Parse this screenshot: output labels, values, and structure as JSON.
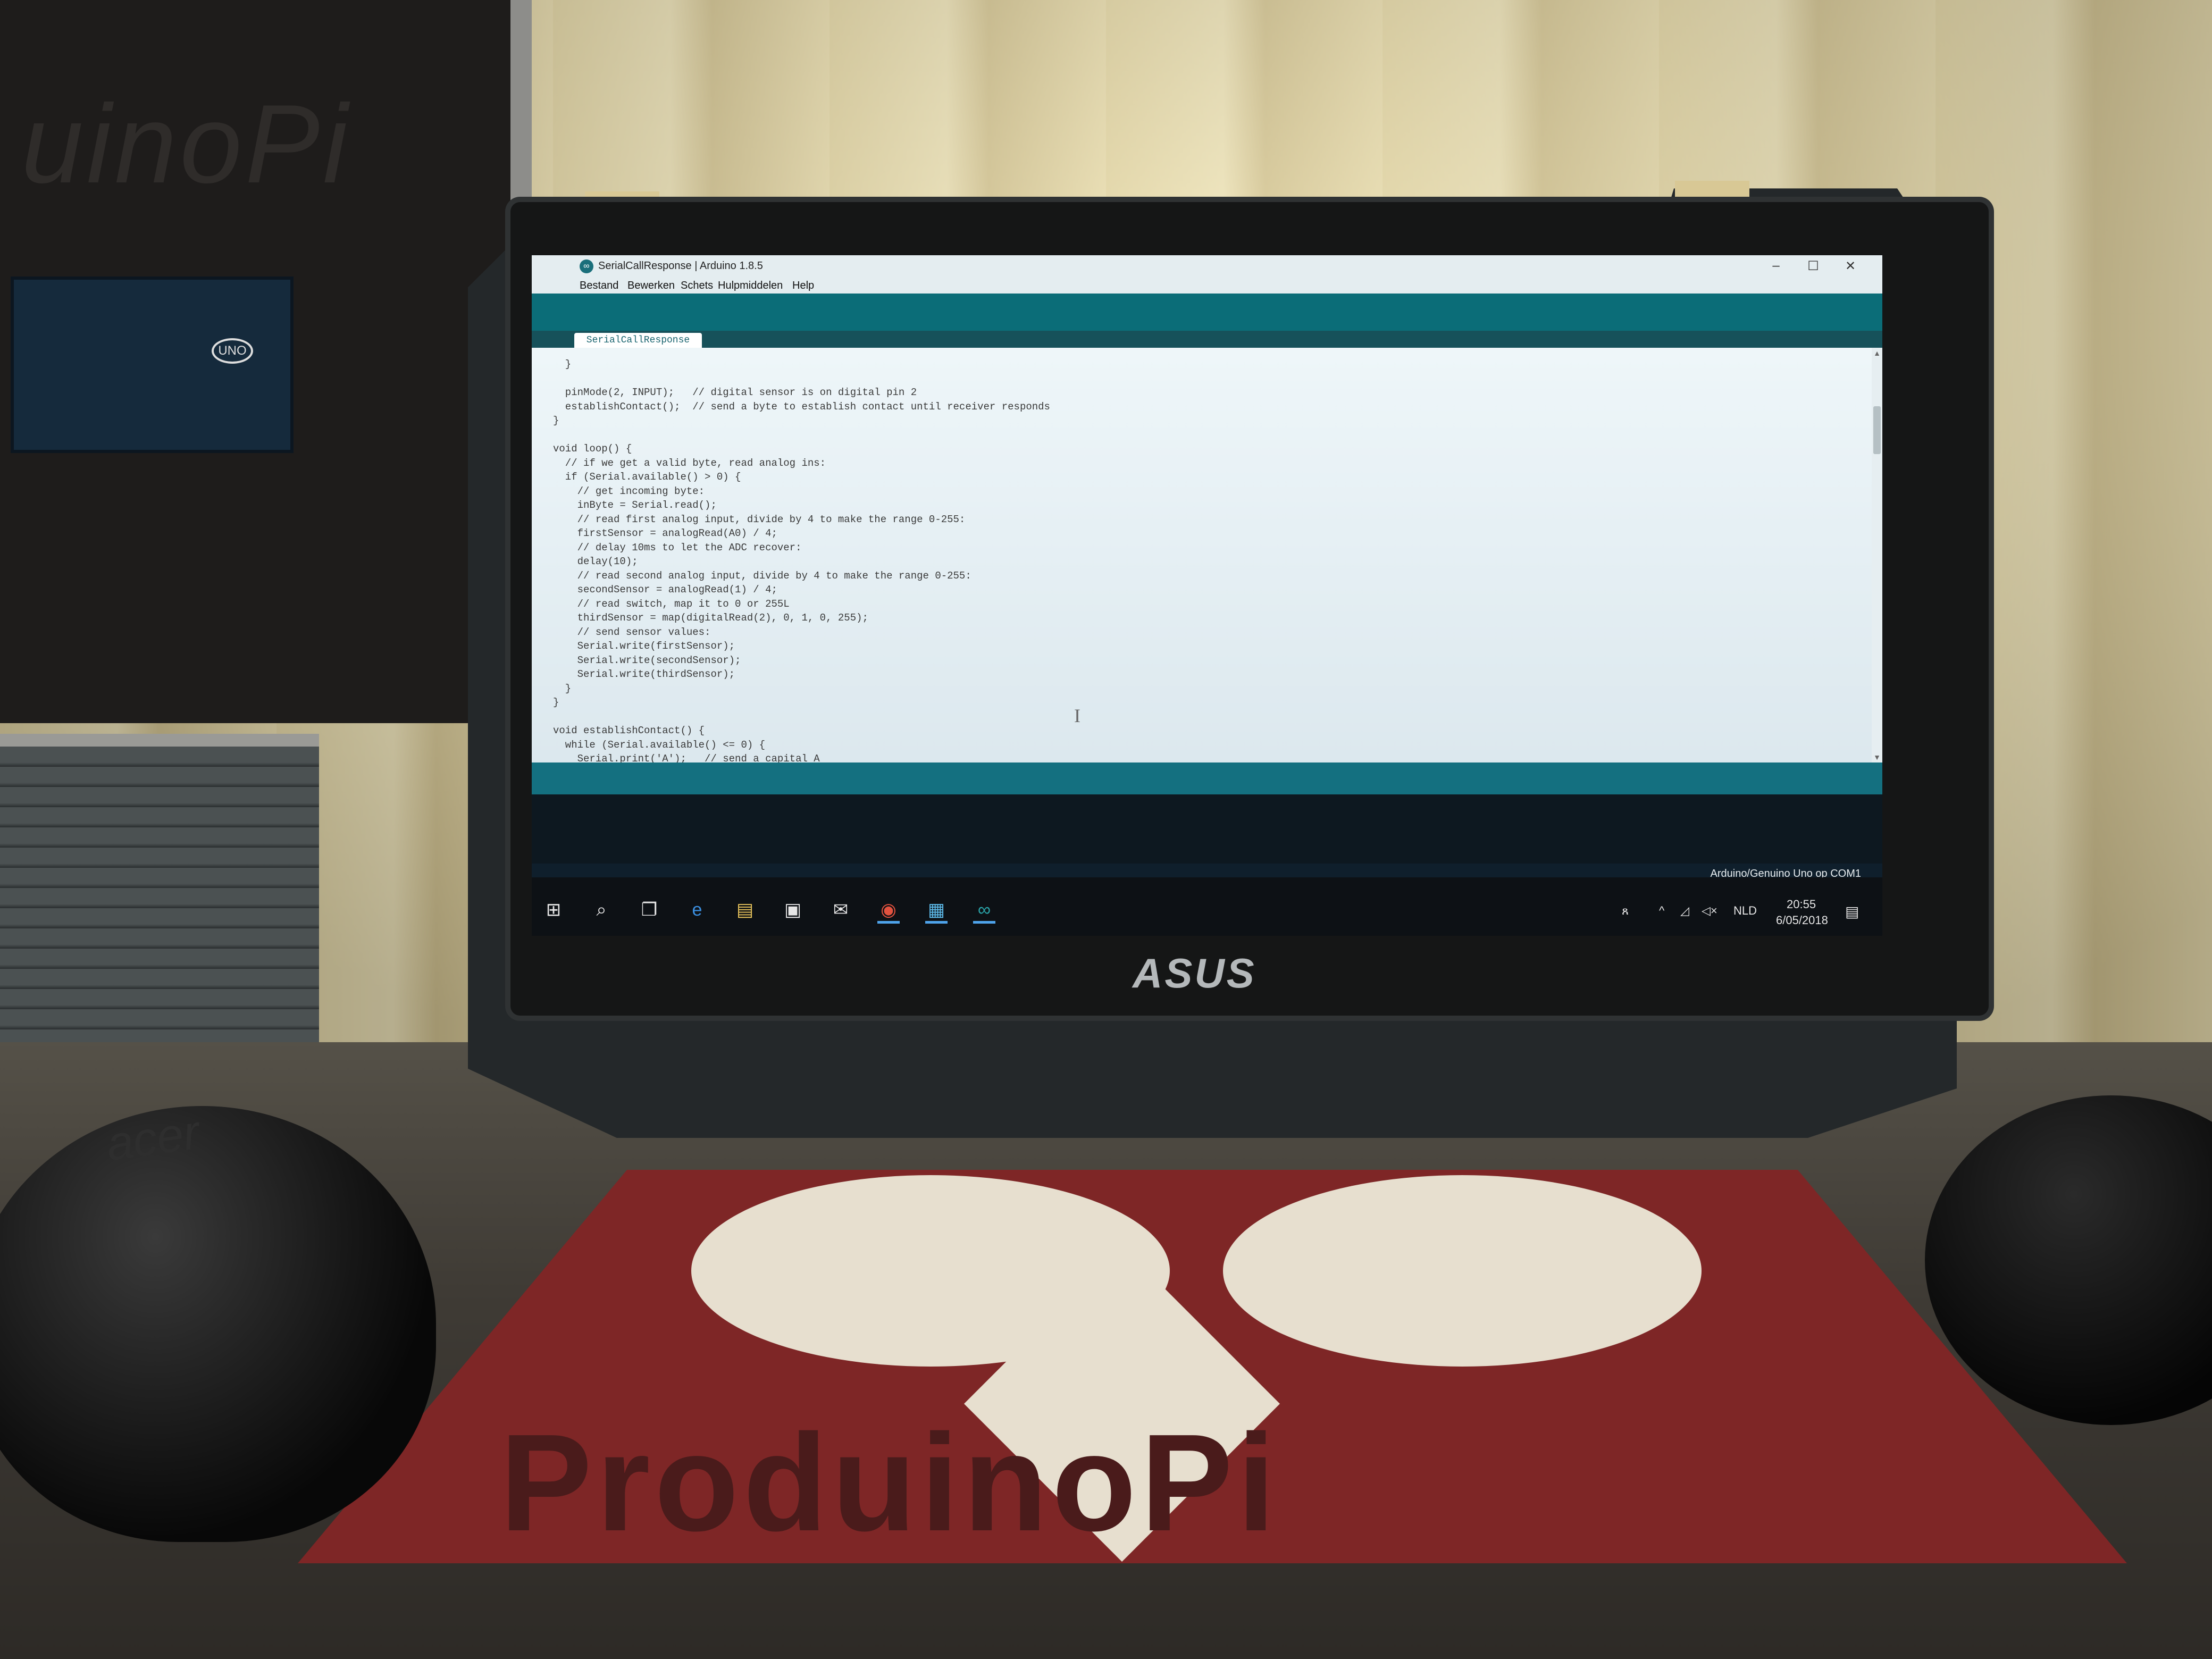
{
  "window": {
    "title": "SerialCallResponse | Arduino 1.8.5",
    "app_logo": "∞",
    "controls": [
      "–",
      "☐",
      "✕"
    ]
  },
  "menu": [
    "Bestand",
    "Bewerken",
    "Schets",
    "Hulpmiddelen",
    "Help"
  ],
  "tab": {
    "label": "SerialCallResponse"
  },
  "code": [
    "  }",
    "",
    "  pinMode(2, INPUT);   // digital sensor is on digital pin 2",
    "  establishContact();  // send a byte to establish contact until receiver responds",
    "}",
    "",
    "void loop() {",
    "  // if we get a valid byte, read analog ins:",
    "  if (Serial.available() > 0) {",
    "    // get incoming byte:",
    "    inByte = Serial.read();",
    "    // read first analog input, divide by 4 to make the range 0-255:",
    "    firstSensor = analogRead(A0) / 4;",
    "    // delay 10ms to let the ADC recover:",
    "    delay(10);",
    "    // read second analog input, divide by 4 to make the range 0-255:",
    "    secondSensor = analogRead(1) / 4;",
    "    // read switch, map it to 0 or 255L",
    "    thirdSensor = map(digitalRead(2), 0, 1, 0, 255);",
    "    // send sensor values:",
    "    Serial.write(firstSensor);",
    "    Serial.write(secondSensor);",
    "    Serial.write(thirdSensor);",
    "  }",
    "}",
    "",
    "void establishContact() {",
    "  while (Serial.available() <= 0) {",
    "    Serial.print('A');   // send a capital A"
  ],
  "status": {
    "board": "Arduino/Genuino Uno op COM1"
  },
  "taskbar": {
    "icons": [
      {
        "name": "start-icon",
        "glyph": "⊞"
      },
      {
        "name": "search-icon",
        "glyph": "⌕"
      },
      {
        "name": "task-view-icon",
        "glyph": "❐"
      },
      {
        "name": "edge-icon",
        "glyph": "e"
      },
      {
        "name": "file-explorer-icon",
        "glyph": "▤"
      },
      {
        "name": "store-icon",
        "glyph": "▣"
      },
      {
        "name": "mail-icon",
        "glyph": "✉"
      },
      {
        "name": "chrome-icon",
        "glyph": "◉"
      },
      {
        "name": "app-window-icon",
        "glyph": "▦"
      },
      {
        "name": "arduino-icon",
        "glyph": "∞"
      }
    ],
    "tray": {
      "language": "NLD",
      "time": "20:55",
      "date": "6/05/2018"
    }
  },
  "monitor_brand": "ASUS",
  "accent_colors": {
    "arduino_teal": "#0b6d78",
    "editor_bg": "#eef6f9",
    "taskbar": "#0d1115"
  }
}
